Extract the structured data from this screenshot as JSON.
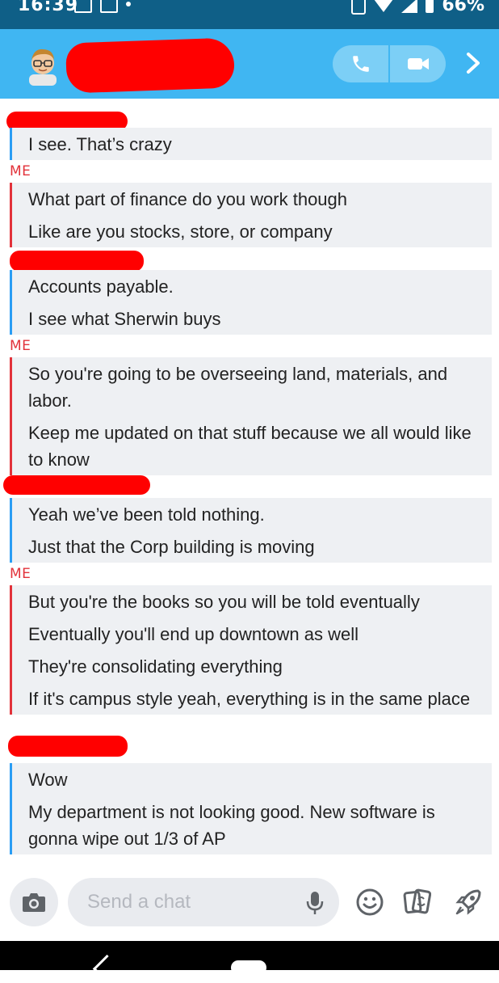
{
  "status_bar": {
    "time": "16:39",
    "battery": "66%"
  },
  "header": {
    "contact_name_redacted": true,
    "call_icon": "phone-icon",
    "video_icon": "video-camera-icon",
    "next_icon": "chevron-right-icon"
  },
  "chat": {
    "blocks": [
      {
        "sender": "",
        "accent": "blue",
        "messages": [
          "I see. That’s crazy"
        ]
      },
      {
        "sender": "ME",
        "accent": "red",
        "messages": [
          "What part of finance do you work though",
          "Like are you stocks, store, or company"
        ]
      },
      {
        "sender": "",
        "accent": "blue",
        "messages": [
          "Accounts payable.",
          "I see what Sherwin buys"
        ]
      },
      {
        "sender": "ME",
        "accent": "red",
        "messages": [
          "So you're going to be overseeing land, materials, and labor.",
          "Keep me updated on that stuff because we all would like to know"
        ]
      },
      {
        "sender": "",
        "accent": "blue",
        "messages": [
          "Yeah we’ve been told nothing.",
          "Just that the Corp building is moving"
        ]
      },
      {
        "sender": "ME",
        "accent": "red",
        "messages": [
          "But you're the books so you will be told eventually",
          "Eventually you'll end up downtown as well",
          "They're consolidating everything",
          "If it's campus style yeah, everything is in the same place"
        ]
      },
      {
        "sender": "",
        "accent": "blue",
        "messages": [
          "Wow",
          "My department is not looking good. New software is gonna wipe out 1/3 of AP"
        ]
      }
    ]
  },
  "input_bar": {
    "placeholder": "Send a chat",
    "icons": [
      "camera-icon",
      "microphone-icon",
      "emoji-icon",
      "stickers-icon",
      "rocket-icon"
    ]
  },
  "colors": {
    "header": "#40b6f2",
    "status_bar": "#0f5f87",
    "me_accent": "#e2323a",
    "friend_accent": "#2a9df4",
    "bubble": "#eef0f3",
    "redaction": "#ff0000"
  }
}
